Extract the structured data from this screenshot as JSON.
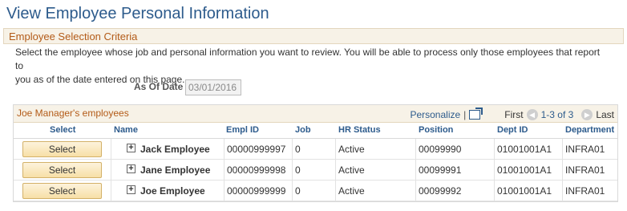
{
  "page": {
    "title": "View Employee Personal Information"
  },
  "criteria": {
    "header": "Employee Selection Criteria",
    "instructions_line1": "Select the employee whose job and personal information you want to review. You will be able to process only those employees that report to",
    "instructions_line2": "you as of the date entered on this page.",
    "as_of_label": "As Of Date",
    "as_of_value": "03/01/2016"
  },
  "grid": {
    "title": "Joe Manager's employees",
    "personalize": "Personalize",
    "separator": "|",
    "first": "First",
    "range": "1-3 of 3",
    "last": "Last",
    "columns": [
      "Select",
      "Name",
      "Empl ID",
      "Job",
      "HR Status",
      "Position",
      "Dept ID",
      "Department"
    ],
    "rows": [
      {
        "select": "Select",
        "name": "Jack Employee",
        "empl_id": "00000999997",
        "job": "0",
        "hr_status": "Active",
        "position": "00099990",
        "dept_id": "01001001A1",
        "department": "INFRA01"
      },
      {
        "select": "Select",
        "name": "Jane Employee",
        "empl_id": "00000999998",
        "job": "0",
        "hr_status": "Active",
        "position": "00099991",
        "dept_id": "01001001A1",
        "department": "INFRA01"
      },
      {
        "select": "Select",
        "name": "Joe Employee",
        "empl_id": "00000999999",
        "job": "0",
        "hr_status": "Active",
        "position": "00099992",
        "dept_id": "01001001A1",
        "department": "INFRA01"
      }
    ]
  },
  "icons": {
    "prev": "◀",
    "next": "▶",
    "expand": "+"
  }
}
